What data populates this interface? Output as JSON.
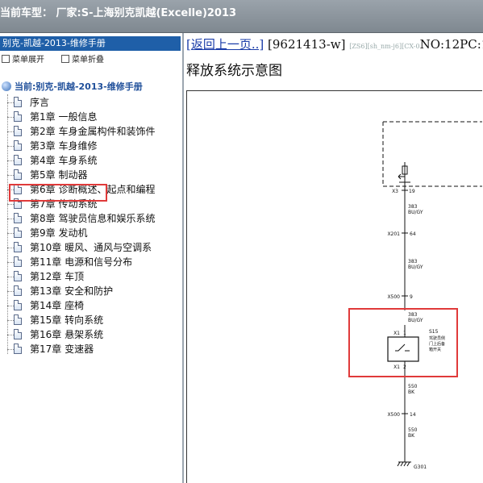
{
  "window": {
    "title": "当前车型：  厂家:S-上海别克凯越(Excelle)2013"
  },
  "left_pane": {
    "header": "别克-凯越-2013-维修手册",
    "expand_label": "菜单展开",
    "collapse_label": "菜单折叠",
    "root_label": "当前:别克-凯越-2013-维修手册",
    "items": [
      {
        "label": "序言"
      },
      {
        "label": "第1章 一般信息"
      },
      {
        "label": "第2章 车身金属构件和装饰件"
      },
      {
        "label": "第3章 车身维修"
      },
      {
        "label": "第4章 车身系统",
        "selected": true
      },
      {
        "label": "第5章 制动器"
      },
      {
        "label": "第6章 诊断概述、起点和编程"
      },
      {
        "label": "第7章 传动系统"
      },
      {
        "label": "第8章 驾驶员信息和娱乐系统"
      },
      {
        "label": "第9章 发动机"
      },
      {
        "label": "第10章 暖风、通风与空调系"
      },
      {
        "label": "第11章 电源和信号分布"
      },
      {
        "label": "第12章 车顶"
      },
      {
        "label": "第13章 安全和防护"
      },
      {
        "label": "第14章 座椅"
      },
      {
        "label": "第15章 转向系统"
      },
      {
        "label": "第16章 悬架系统"
      },
      {
        "label": "第17章 变速器"
      }
    ],
    "highlight_color": "#e03a3a"
  },
  "document": {
    "back_link": "[返回上一页..]",
    "doc_id": "[9621413-w]",
    "meta_small": "[ZS6][sh_nm-j6][CX-0",
    "page_info": "NO:12PC:1 .",
    "title": "释放系统示意图"
  },
  "diagram": {
    "connectors": {
      "top": {
        "ref": "X3",
        "pin": "19"
      },
      "mid": {
        "ref": "X201",
        "pin": "64"
      },
      "low": {
        "ref": "X500",
        "pin": "9"
      },
      "switch_top": {
        "ref": "X1",
        "pin": "1"
      },
      "switch_bottom": {
        "ref": "X1",
        "pin": "2"
      },
      "bottom": {
        "ref": "X500",
        "pin": "14"
      }
    },
    "wires": [
      {
        "circuit": "383",
        "color": "BU/GY"
      },
      {
        "circuit": "383",
        "color": "BU/GY"
      },
      {
        "circuit": "383",
        "color": "BU/GY"
      },
      {
        "circuit": "550",
        "color": "BK"
      },
      {
        "circuit": "550",
        "color": "BK"
      }
    ],
    "switch": {
      "ref": "S15",
      "desc_line1": "驾驶员侧",
      "desc_line2": "门上后备",
      "desc_line3": "箱开关"
    },
    "ground": "G301",
    "highlight_color": "#e03a3a"
  }
}
